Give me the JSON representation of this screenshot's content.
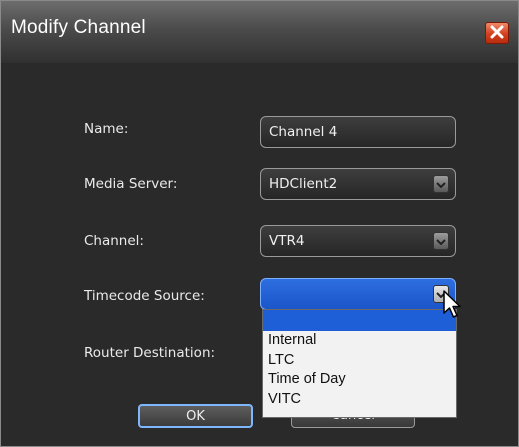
{
  "window": {
    "title": "Modify Channel",
    "close_label": "close"
  },
  "form": {
    "name_label": "Name:",
    "name_value": "Channel 4",
    "media_server_label": "Media Server:",
    "media_server_value": "HDClient2",
    "channel_label": "Channel:",
    "channel_value": "VTR4",
    "timecode_label": "Timecode Source:",
    "timecode_value": "",
    "router_label": "Router Destination:"
  },
  "timecode_options": [
    "Internal",
    "LTC",
    "Time of Day",
    "VITC"
  ],
  "buttons": {
    "ok": "OK",
    "cancel": "Cancel"
  },
  "colors": {
    "titlebar": "#4b4b4b",
    "dialog_bg": "#2a2a2a",
    "close_button": "#d2401d",
    "selection": "#1e5fd8",
    "focus_border": "#7fb7ff"
  },
  "icons": [
    "close-icon",
    "chevron-down-icon",
    "mouse-pointer-icon"
  ]
}
